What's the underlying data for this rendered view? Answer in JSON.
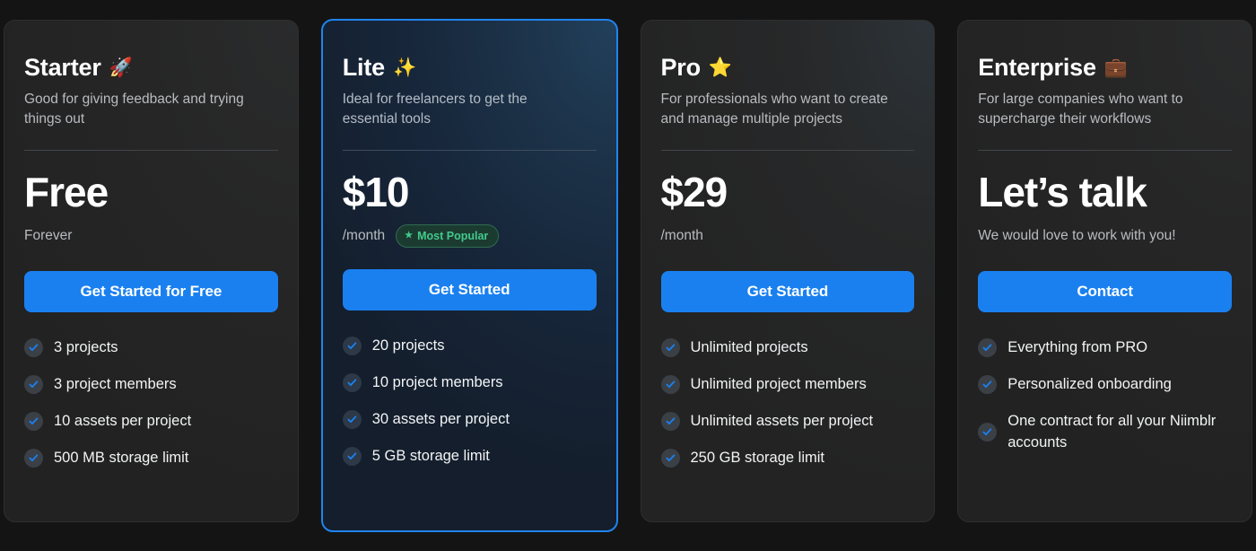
{
  "page": {
    "background_color": "#141414",
    "accent_color": "#1a80f0",
    "badge_color": "#43c98d"
  },
  "plans": [
    {
      "name": "Starter",
      "emoji": "🚀",
      "emoji_name": "rocket-emoji",
      "description": "Good for giving feedback and trying things out",
      "price": "Free",
      "period": "Forever",
      "badge": null,
      "cta_label": "Get Started for Free",
      "featured": false,
      "features": [
        "3 projects",
        "3 project members",
        "10 assets per project",
        "500 MB storage limit"
      ]
    },
    {
      "name": "Lite",
      "emoji": "✨",
      "emoji_name": "sparkles-emoji",
      "description": "Ideal for freelancers to get the essential tools",
      "price": "$10",
      "period": "/month",
      "badge": "Most Popular",
      "badge_star": "★",
      "cta_label": "Get Started",
      "featured": true,
      "features": [
        "20 projects",
        "10 project members",
        "30 assets per project",
        "5 GB storage limit"
      ]
    },
    {
      "name": "Pro",
      "emoji": "⭐",
      "emoji_name": "star-emoji",
      "description": "For professionals who want to create and manage multiple projects",
      "price": "$29",
      "period": "/month",
      "badge": null,
      "cta_label": "Get Started",
      "featured": false,
      "features": [
        "Unlimited projects",
        "Unlimited project members",
        "Unlimited assets per project",
        "250 GB storage limit"
      ]
    },
    {
      "name": "Enterprise",
      "emoji": "💼",
      "emoji_name": "briefcase-emoji",
      "description": "For large companies who want to supercharge their workflows",
      "price": "Let’s talk",
      "period": "We would love to work with you!",
      "badge": null,
      "cta_label": "Contact",
      "featured": false,
      "features": [
        "Everything from PRO",
        "Personalized onboarding",
        "One contract for all your Niimblr accounts"
      ]
    }
  ]
}
